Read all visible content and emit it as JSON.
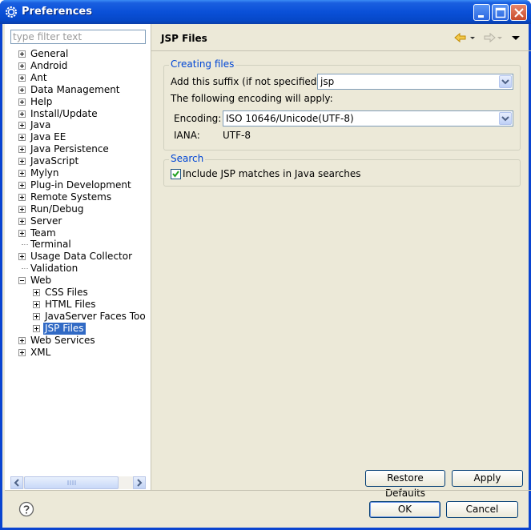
{
  "window": {
    "title": "Preferences"
  },
  "filter": {
    "placeholder": "type filter text"
  },
  "tree": [
    {
      "label": "General",
      "toggle": "plus",
      "depth": 0
    },
    {
      "label": "Android",
      "toggle": "plus",
      "depth": 0
    },
    {
      "label": "Ant",
      "toggle": "plus",
      "depth": 0
    },
    {
      "label": "Data Management",
      "toggle": "plus",
      "depth": 0
    },
    {
      "label": "Help",
      "toggle": "plus",
      "depth": 0
    },
    {
      "label": "Install/Update",
      "toggle": "plus",
      "depth": 0
    },
    {
      "label": "Java",
      "toggle": "plus",
      "depth": 0
    },
    {
      "label": "Java EE",
      "toggle": "plus",
      "depth": 0
    },
    {
      "label": "Java Persistence",
      "toggle": "plus",
      "depth": 0
    },
    {
      "label": "JavaScript",
      "toggle": "plus",
      "depth": 0
    },
    {
      "label": "Mylyn",
      "toggle": "plus",
      "depth": 0
    },
    {
      "label": "Plug-in Development",
      "toggle": "plus",
      "depth": 0
    },
    {
      "label": "Remote Systems",
      "toggle": "plus",
      "depth": 0
    },
    {
      "label": "Run/Debug",
      "toggle": "plus",
      "depth": 0
    },
    {
      "label": "Server",
      "toggle": "plus",
      "depth": 0
    },
    {
      "label": "Team",
      "toggle": "plus",
      "depth": 0
    },
    {
      "label": "Terminal",
      "toggle": "none",
      "depth": 0
    },
    {
      "label": "Usage Data Collector",
      "toggle": "plus",
      "depth": 0
    },
    {
      "label": "Validation",
      "toggle": "none",
      "depth": 0
    },
    {
      "label": "Web",
      "toggle": "minus",
      "depth": 0
    },
    {
      "label": "CSS Files",
      "toggle": "plus",
      "depth": 1
    },
    {
      "label": "HTML Files",
      "toggle": "plus",
      "depth": 1
    },
    {
      "label": "JavaServer Faces Too",
      "toggle": "plus",
      "depth": 1
    },
    {
      "label": "JSP Files",
      "toggle": "plus",
      "depth": 1,
      "selected": true
    },
    {
      "label": "Web Services",
      "toggle": "plus",
      "depth": 0
    },
    {
      "label": "XML",
      "toggle": "plus",
      "depth": 0
    }
  ],
  "page": {
    "title": "JSP Files"
  },
  "creating_files": {
    "legend": "Creating files",
    "suffix_label": "Add this suffix (if not specified):",
    "suffix_value": "jsp",
    "encoding_note": "The following encoding will apply:",
    "encoding_label": "Encoding:",
    "encoding_value": "ISO 10646/Unicode(UTF-8)",
    "iana_label": "IANA:",
    "iana_value": "UTF-8"
  },
  "search": {
    "legend": "Search",
    "include_label": "Include JSP matches in Java searches",
    "include_checked": true
  },
  "buttons": {
    "restore_defaults": "Restore Defaults",
    "apply": "Apply",
    "ok": "OK",
    "cancel": "Cancel"
  },
  "colors": {
    "accent": "#0046d5",
    "selection": "#316ac5",
    "titlebar": "#0a50d8"
  }
}
